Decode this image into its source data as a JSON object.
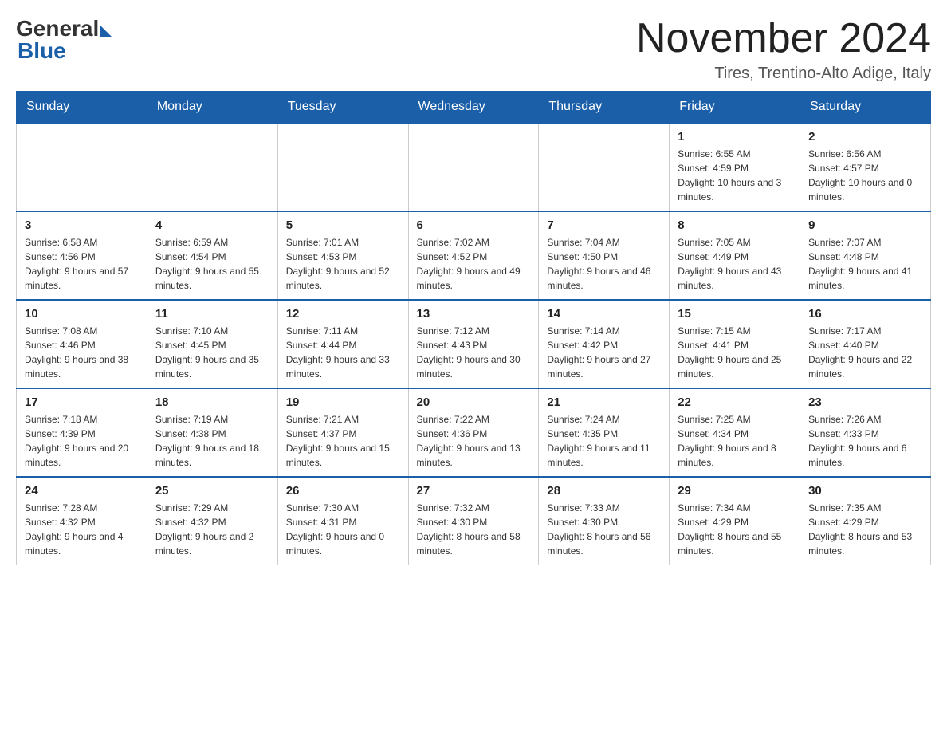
{
  "header": {
    "logo_general": "General",
    "logo_blue": "Blue",
    "month_title": "November 2024",
    "subtitle": "Tires, Trentino-Alto Adige, Italy"
  },
  "weekdays": [
    "Sunday",
    "Monday",
    "Tuesday",
    "Wednesday",
    "Thursday",
    "Friday",
    "Saturday"
  ],
  "weeks": [
    {
      "days": [
        {
          "number": "",
          "info": ""
        },
        {
          "number": "",
          "info": ""
        },
        {
          "number": "",
          "info": ""
        },
        {
          "number": "",
          "info": ""
        },
        {
          "number": "",
          "info": ""
        },
        {
          "number": "1",
          "info": "Sunrise: 6:55 AM\nSunset: 4:59 PM\nDaylight: 10 hours and 3 minutes."
        },
        {
          "number": "2",
          "info": "Sunrise: 6:56 AM\nSunset: 4:57 PM\nDaylight: 10 hours and 0 minutes."
        }
      ]
    },
    {
      "days": [
        {
          "number": "3",
          "info": "Sunrise: 6:58 AM\nSunset: 4:56 PM\nDaylight: 9 hours and 57 minutes."
        },
        {
          "number": "4",
          "info": "Sunrise: 6:59 AM\nSunset: 4:54 PM\nDaylight: 9 hours and 55 minutes."
        },
        {
          "number": "5",
          "info": "Sunrise: 7:01 AM\nSunset: 4:53 PM\nDaylight: 9 hours and 52 minutes."
        },
        {
          "number": "6",
          "info": "Sunrise: 7:02 AM\nSunset: 4:52 PM\nDaylight: 9 hours and 49 minutes."
        },
        {
          "number": "7",
          "info": "Sunrise: 7:04 AM\nSunset: 4:50 PM\nDaylight: 9 hours and 46 minutes."
        },
        {
          "number": "8",
          "info": "Sunrise: 7:05 AM\nSunset: 4:49 PM\nDaylight: 9 hours and 43 minutes."
        },
        {
          "number": "9",
          "info": "Sunrise: 7:07 AM\nSunset: 4:48 PM\nDaylight: 9 hours and 41 minutes."
        }
      ]
    },
    {
      "days": [
        {
          "number": "10",
          "info": "Sunrise: 7:08 AM\nSunset: 4:46 PM\nDaylight: 9 hours and 38 minutes."
        },
        {
          "number": "11",
          "info": "Sunrise: 7:10 AM\nSunset: 4:45 PM\nDaylight: 9 hours and 35 minutes."
        },
        {
          "number": "12",
          "info": "Sunrise: 7:11 AM\nSunset: 4:44 PM\nDaylight: 9 hours and 33 minutes."
        },
        {
          "number": "13",
          "info": "Sunrise: 7:12 AM\nSunset: 4:43 PM\nDaylight: 9 hours and 30 minutes."
        },
        {
          "number": "14",
          "info": "Sunrise: 7:14 AM\nSunset: 4:42 PM\nDaylight: 9 hours and 27 minutes."
        },
        {
          "number": "15",
          "info": "Sunrise: 7:15 AM\nSunset: 4:41 PM\nDaylight: 9 hours and 25 minutes."
        },
        {
          "number": "16",
          "info": "Sunrise: 7:17 AM\nSunset: 4:40 PM\nDaylight: 9 hours and 22 minutes."
        }
      ]
    },
    {
      "days": [
        {
          "number": "17",
          "info": "Sunrise: 7:18 AM\nSunset: 4:39 PM\nDaylight: 9 hours and 20 minutes."
        },
        {
          "number": "18",
          "info": "Sunrise: 7:19 AM\nSunset: 4:38 PM\nDaylight: 9 hours and 18 minutes."
        },
        {
          "number": "19",
          "info": "Sunrise: 7:21 AM\nSunset: 4:37 PM\nDaylight: 9 hours and 15 minutes."
        },
        {
          "number": "20",
          "info": "Sunrise: 7:22 AM\nSunset: 4:36 PM\nDaylight: 9 hours and 13 minutes."
        },
        {
          "number": "21",
          "info": "Sunrise: 7:24 AM\nSunset: 4:35 PM\nDaylight: 9 hours and 11 minutes."
        },
        {
          "number": "22",
          "info": "Sunrise: 7:25 AM\nSunset: 4:34 PM\nDaylight: 9 hours and 8 minutes."
        },
        {
          "number": "23",
          "info": "Sunrise: 7:26 AM\nSunset: 4:33 PM\nDaylight: 9 hours and 6 minutes."
        }
      ]
    },
    {
      "days": [
        {
          "number": "24",
          "info": "Sunrise: 7:28 AM\nSunset: 4:32 PM\nDaylight: 9 hours and 4 minutes."
        },
        {
          "number": "25",
          "info": "Sunrise: 7:29 AM\nSunset: 4:32 PM\nDaylight: 9 hours and 2 minutes."
        },
        {
          "number": "26",
          "info": "Sunrise: 7:30 AM\nSunset: 4:31 PM\nDaylight: 9 hours and 0 minutes."
        },
        {
          "number": "27",
          "info": "Sunrise: 7:32 AM\nSunset: 4:30 PM\nDaylight: 8 hours and 58 minutes."
        },
        {
          "number": "28",
          "info": "Sunrise: 7:33 AM\nSunset: 4:30 PM\nDaylight: 8 hours and 56 minutes."
        },
        {
          "number": "29",
          "info": "Sunrise: 7:34 AM\nSunset: 4:29 PM\nDaylight: 8 hours and 55 minutes."
        },
        {
          "number": "30",
          "info": "Sunrise: 7:35 AM\nSunset: 4:29 PM\nDaylight: 8 hours and 53 minutes."
        }
      ]
    }
  ]
}
